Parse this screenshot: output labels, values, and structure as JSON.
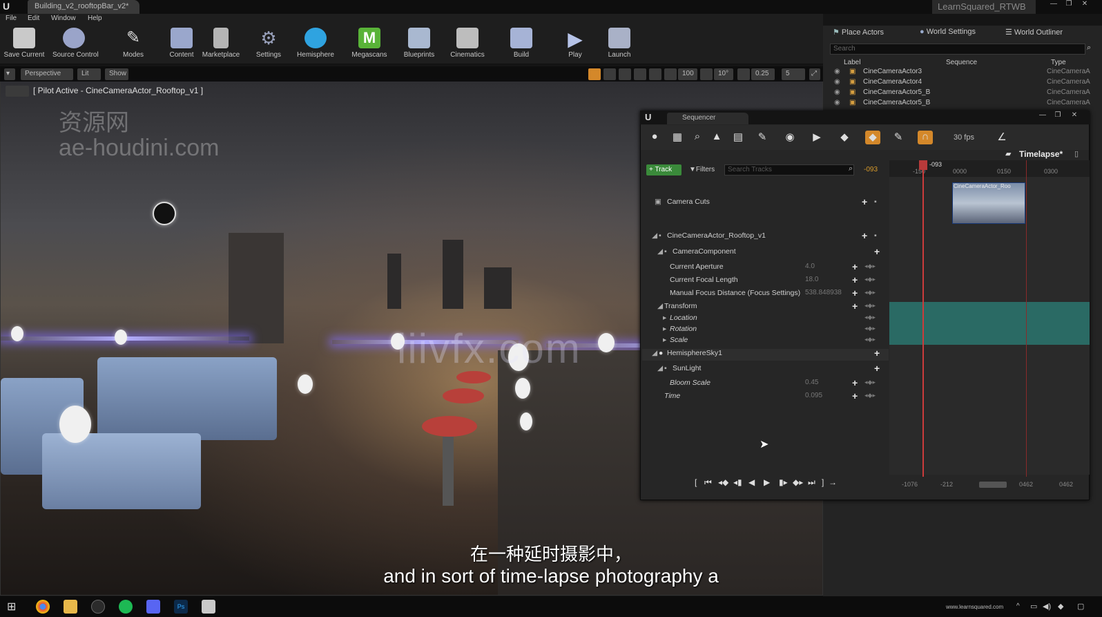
{
  "window": {
    "doc_tab": "Building_v2_rooftopBar_v2*",
    "project": "LearnSquared_RTWB",
    "min": "—",
    "max": "❐",
    "close": "✕"
  },
  "menu": [
    "File",
    "Edit",
    "Window",
    "Help"
  ],
  "toolbar": [
    {
      "label": "Save Current",
      "icon": "save-icon",
      "color": "#c9c9c9"
    },
    {
      "label": "Source Control",
      "icon": "source-control-icon",
      "color": "#9aa4c9"
    },
    {
      "label": "Modes",
      "icon": "modes-icon",
      "color": "#cfcfcf"
    },
    {
      "label": "Content",
      "icon": "content-icon",
      "color": "#9aa7cc"
    },
    {
      "label": "Marketplace",
      "icon": "marketplace-icon",
      "color": "#b5b5b5"
    },
    {
      "label": "Settings",
      "icon": "settings-icon",
      "color": "#9aa2bd"
    },
    {
      "label": "Hemisphere",
      "icon": "hemisphere-icon",
      "color": "#2fa3e0"
    },
    {
      "label": "Megascans",
      "icon": "megascans-icon",
      "color": "#59b338"
    },
    {
      "label": "Blueprints",
      "icon": "blueprints-icon",
      "color": "#a9b8d0"
    },
    {
      "label": "Cinematics",
      "icon": "cinematics-icon",
      "color": "#bdbdbd"
    },
    {
      "label": "Build",
      "icon": "build-icon",
      "color": "#a6b3d6"
    },
    {
      "label": "Play",
      "icon": "play-icon",
      "color": "#b6c3e8"
    },
    {
      "label": "Launch",
      "icon": "launch-icon",
      "color": "#a9b1c7"
    }
  ],
  "viewport": {
    "perspective": "Perspective",
    "lit": "Lit",
    "show": "Show",
    "pilot": "[ Pilot Active - CineCameraActor_Rooftop_v1 ]",
    "grid_value": "100",
    "angle_value": "10°",
    "scale_value": "0.25",
    "cam_speed": "5",
    "watermark": "资源网\nae-houdini.com",
    "watermark2": "iiivfx.com"
  },
  "subtitles": {
    "cn": "在一种延时摄影中，",
    "en": "and in sort of time-lapse photography a"
  },
  "right_panel": {
    "tabs": [
      "Place Actors",
      "World Settings",
      "World Outliner"
    ],
    "search_placeholder": "Search",
    "columns": [
      "Label",
      "Sequence",
      "Type"
    ],
    "rows": [
      {
        "label": "CineCameraActor3",
        "type": "CineCameraA"
      },
      {
        "label": "CineCameraActor4",
        "type": "CineCameraA"
      },
      {
        "label": "CineCameraActor5_B",
        "type": "CineCameraA"
      },
      {
        "label": "CineCameraActor5_B",
        "type": "CineCameraA"
      }
    ]
  },
  "sequencer": {
    "tab": "Sequencer",
    "fps": "30 fps",
    "sequence_name": "Timelapse*",
    "track_btn": "Track",
    "filters_btn": "Filters",
    "search_placeholder": "Search Tracks",
    "frame_readout": "-093",
    "playhead_label": "-093",
    "ruler_ticks": [
      "-150",
      "0000",
      "0150",
      "0300"
    ],
    "cut_thumb_label": "CineCameraActor_Roo",
    "tracks": [
      {
        "name": "Camera Cuts",
        "value": ""
      },
      {
        "name": "CineCameraActor_Rooftop_v1",
        "value": ""
      },
      {
        "name": "CameraComponent",
        "value": ""
      },
      {
        "name": "Current Aperture",
        "value": "4.0"
      },
      {
        "name": "Current Focal Length",
        "value": "18.0"
      },
      {
        "name": "Manual Focus Distance (Focus Settings)",
        "value": "538.848938"
      },
      {
        "name": "Transform",
        "value": ""
      },
      {
        "name": "Location",
        "value": ""
      },
      {
        "name": "Rotation",
        "value": ""
      },
      {
        "name": "Scale",
        "value": ""
      },
      {
        "name": "HemisphereSky1",
        "value": ""
      },
      {
        "name": "SunLight",
        "value": ""
      },
      {
        "name": "Bloom Scale",
        "value": "0.45"
      },
      {
        "name": "Time",
        "value": "0.095"
      }
    ],
    "footer": [
      "-1076",
      "-212",
      "0462",
      "0462"
    ]
  },
  "taskbar": {
    "url": "www.learnsquared.com"
  }
}
